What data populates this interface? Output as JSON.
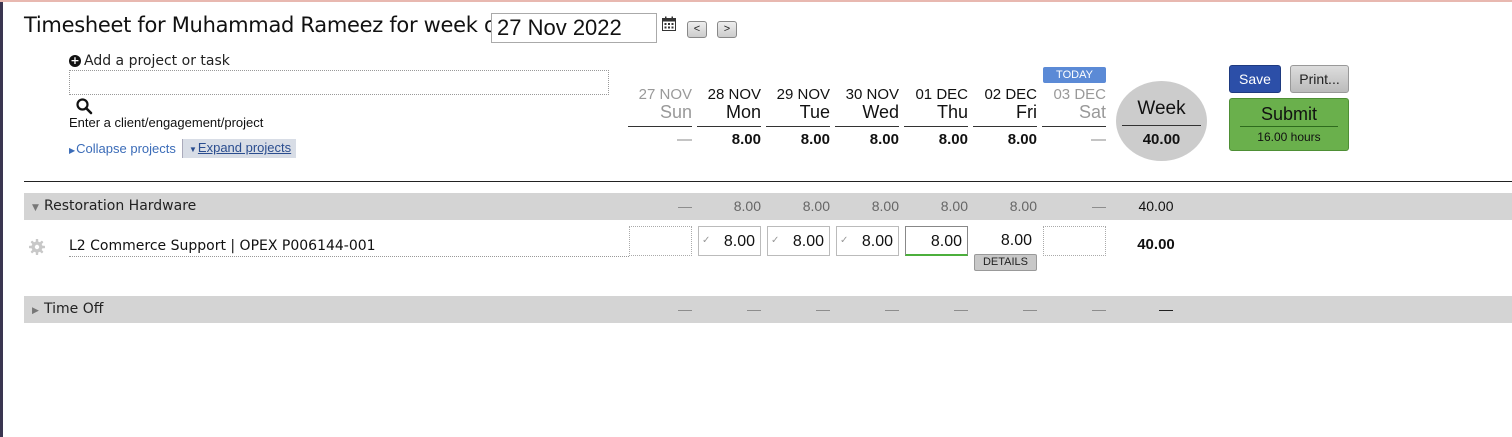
{
  "header": {
    "title": "Timesheet for Muhammad Rameez for week of",
    "week_date": "27 Nov 2022",
    "prev_label": "<",
    "next_label": ">"
  },
  "project_search": {
    "add_label": "Add a project or task",
    "value": "",
    "hint": "Enter a client/engagement/project",
    "collapse_label": "Collapse projects",
    "expand_label": "Expand projects"
  },
  "today_badge": "TODAY",
  "days": [
    {
      "date": "27 NOV",
      "day": "Sun",
      "weekend": true,
      "total": "—"
    },
    {
      "date": "28 NOV",
      "day": "Mon",
      "weekend": false,
      "total": "8.00"
    },
    {
      "date": "29 NOV",
      "day": "Tue",
      "weekend": false,
      "total": "8.00"
    },
    {
      "date": "30 NOV",
      "day": "Wed",
      "weekend": false,
      "total": "8.00"
    },
    {
      "date": "01 DEC",
      "day": "Thu",
      "weekend": false,
      "total": "8.00"
    },
    {
      "date": "02 DEC",
      "day": "Fri",
      "weekend": false,
      "total": "8.00"
    },
    {
      "date": "03 DEC",
      "day": "Sat",
      "weekend": true,
      "total": "—"
    }
  ],
  "week": {
    "label": "Week",
    "total": "40.00"
  },
  "actions": {
    "save_label": "Save",
    "print_label": "Print...",
    "submit_label": "Submit",
    "submit_hours": "16.00 hours"
  },
  "groups": [
    {
      "name": "Restoration Hardware",
      "expanded": true,
      "day_totals": [
        "—",
        "8.00",
        "8.00",
        "8.00",
        "8.00",
        "8.00",
        "—"
      ],
      "week_total": "40.00",
      "tasks": [
        {
          "name": "L2 Commerce Support | OPEX P006144-001",
          "hours": [
            "",
            "8.00",
            "8.00",
            "8.00",
            "8.00",
            "8.00",
            ""
          ],
          "week_total": "40.00",
          "details_label": "DETAILS"
        }
      ]
    },
    {
      "name": "Time Off",
      "expanded": false,
      "day_totals": [
        "—",
        "—",
        "—",
        "—",
        "—",
        "—",
        "—"
      ],
      "week_total": "—"
    }
  ],
  "colors": {
    "save": "#2c4fa8",
    "submit": "#6ab04c",
    "today_badge": "#5b8ad6",
    "group_bg": "#d4d4d4"
  }
}
